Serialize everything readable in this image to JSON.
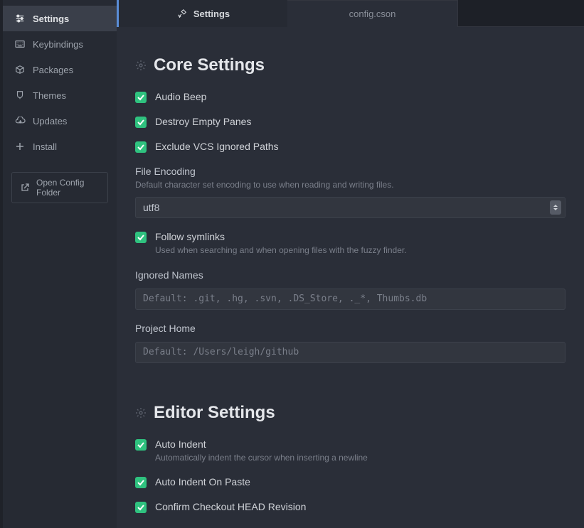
{
  "tabs": {
    "settings": "Settings",
    "config": "config.cson"
  },
  "sidebar": {
    "items": [
      {
        "label": "Settings"
      },
      {
        "label": "Keybindings"
      },
      {
        "label": "Packages"
      },
      {
        "label": "Themes"
      },
      {
        "label": "Updates"
      },
      {
        "label": "Install"
      }
    ],
    "open_config": "Open Config Folder"
  },
  "core": {
    "title": "Core Settings",
    "audio_beep": "Audio Beep",
    "destroy_empty_panes": "Destroy Empty Panes",
    "exclude_vcs": "Exclude VCS Ignored Paths",
    "file_encoding": {
      "label": "File Encoding",
      "help": "Default character set encoding to use when reading and writing files.",
      "value": "utf8"
    },
    "follow_symlinks": {
      "label": "Follow symlinks",
      "help": "Used when searching and when opening files with the fuzzy finder."
    },
    "ignored_names": {
      "label": "Ignored Names",
      "placeholder": "Default: .git, .hg, .svn, .DS_Store, ._*, Thumbs.db"
    },
    "project_home": {
      "label": "Project Home",
      "placeholder": "Default: /Users/leigh/github"
    }
  },
  "editor": {
    "title": "Editor Settings",
    "auto_indent": {
      "label": "Auto Indent",
      "help": "Automatically indent the cursor when inserting a newline"
    },
    "auto_indent_on_paste": "Auto Indent On Paste",
    "confirm_checkout": "Confirm Checkout HEAD Revision"
  }
}
